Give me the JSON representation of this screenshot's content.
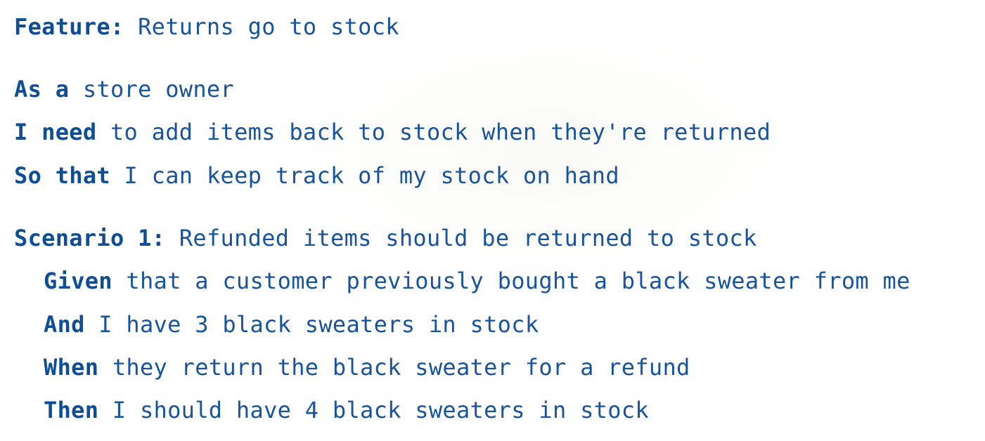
{
  "feature": {
    "keyword": "Feature:",
    "title": "Returns go to stock"
  },
  "story": [
    {
      "keyword": "As a",
      "text": "store owner"
    },
    {
      "keyword": "I need",
      "text": "to add items back to stock when they're returned"
    },
    {
      "keyword": "So that",
      "text": "I can keep track of my stock on hand"
    }
  ],
  "scenario": {
    "keyword": "Scenario 1:",
    "title": "Refunded items should be returned to stock",
    "steps": [
      {
        "keyword": "Given",
        "text": "that a customer previously bought a black sweater from me"
      },
      {
        "keyword": "And",
        "text": "I have 3 black sweaters in stock"
      },
      {
        "keyword": "When",
        "text": "they return the black sweater for a refund"
      },
      {
        "keyword": "Then",
        "text": "I should have 4 black sweaters in stock"
      }
    ]
  },
  "colors": {
    "text": "#17549c",
    "background": "#ffffff"
  }
}
